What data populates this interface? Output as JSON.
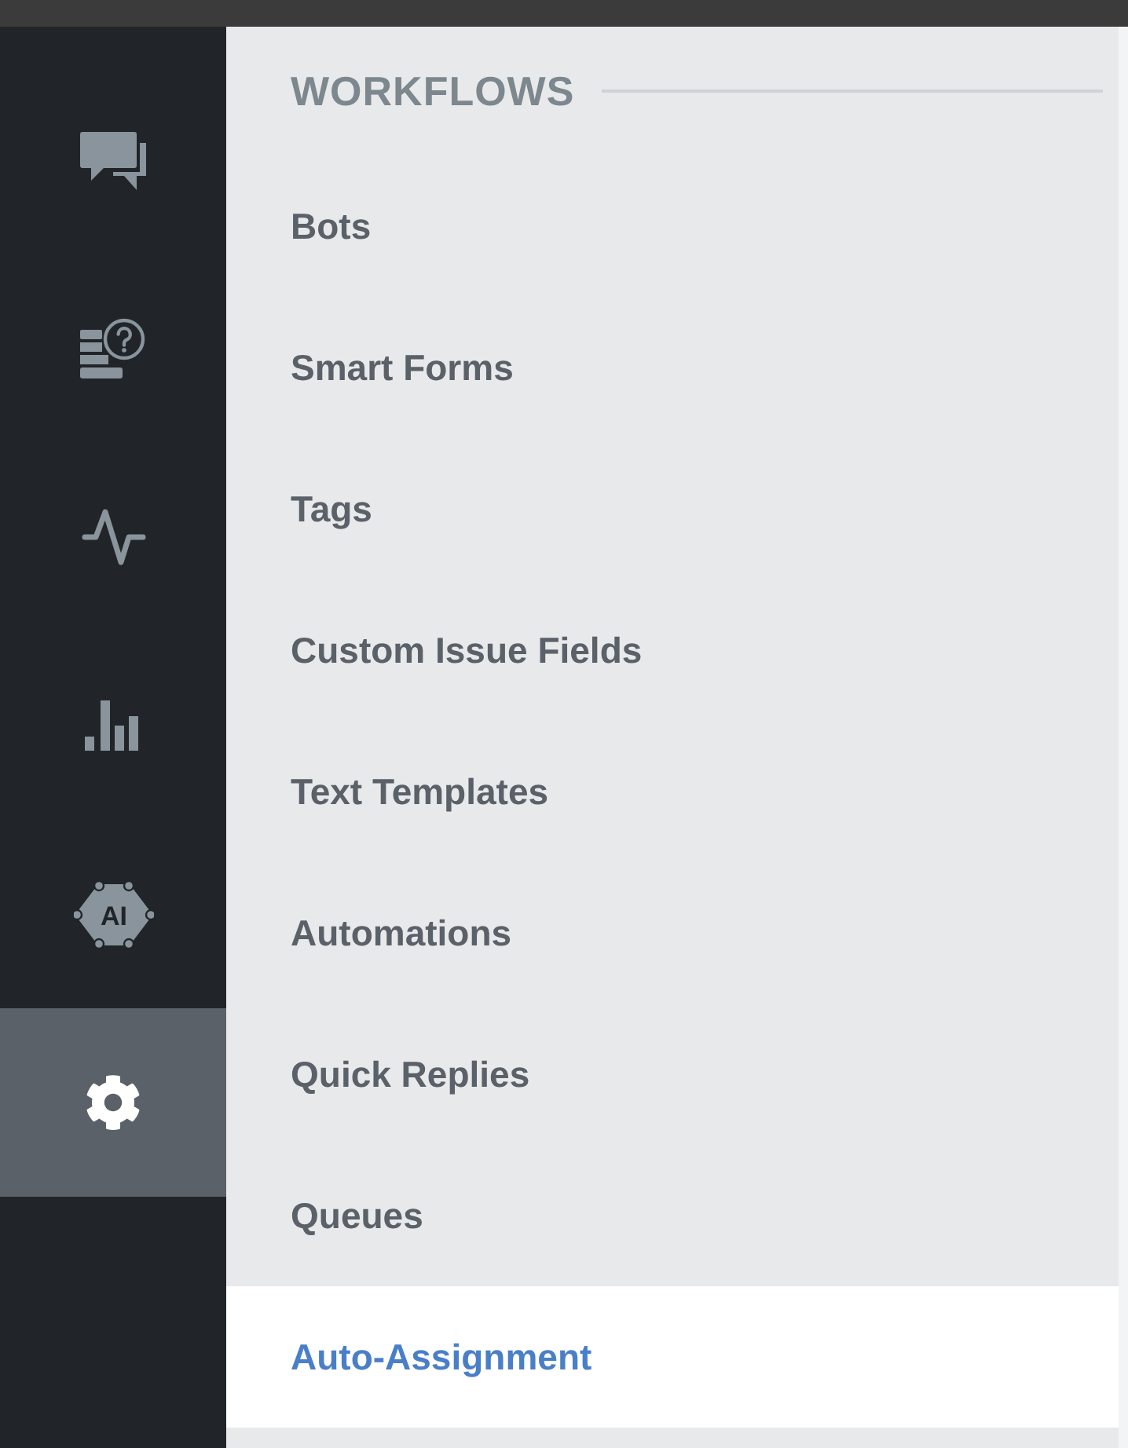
{
  "sidebar": {
    "items": [
      {
        "kind": "chat",
        "selected": false
      },
      {
        "kind": "help-doc",
        "selected": false
      },
      {
        "kind": "activity",
        "selected": false
      },
      {
        "kind": "bar-chart",
        "selected": false
      },
      {
        "kind": "ai",
        "label": "AI",
        "selected": false
      },
      {
        "kind": "settings",
        "selected": true
      }
    ]
  },
  "menu": {
    "heading": "WORKFLOWS",
    "items": [
      {
        "label": "Bots",
        "selected": false
      },
      {
        "label": "Smart Forms",
        "selected": false
      },
      {
        "label": "Tags",
        "selected": false
      },
      {
        "label": "Custom Issue Fields",
        "selected": false
      },
      {
        "label": "Text Templates",
        "selected": false
      },
      {
        "label": "Automations",
        "selected": false
      },
      {
        "label": "Quick Replies",
        "selected": false
      },
      {
        "label": "Queues",
        "selected": false
      },
      {
        "label": "Auto-Assignment",
        "selected": true
      }
    ]
  }
}
